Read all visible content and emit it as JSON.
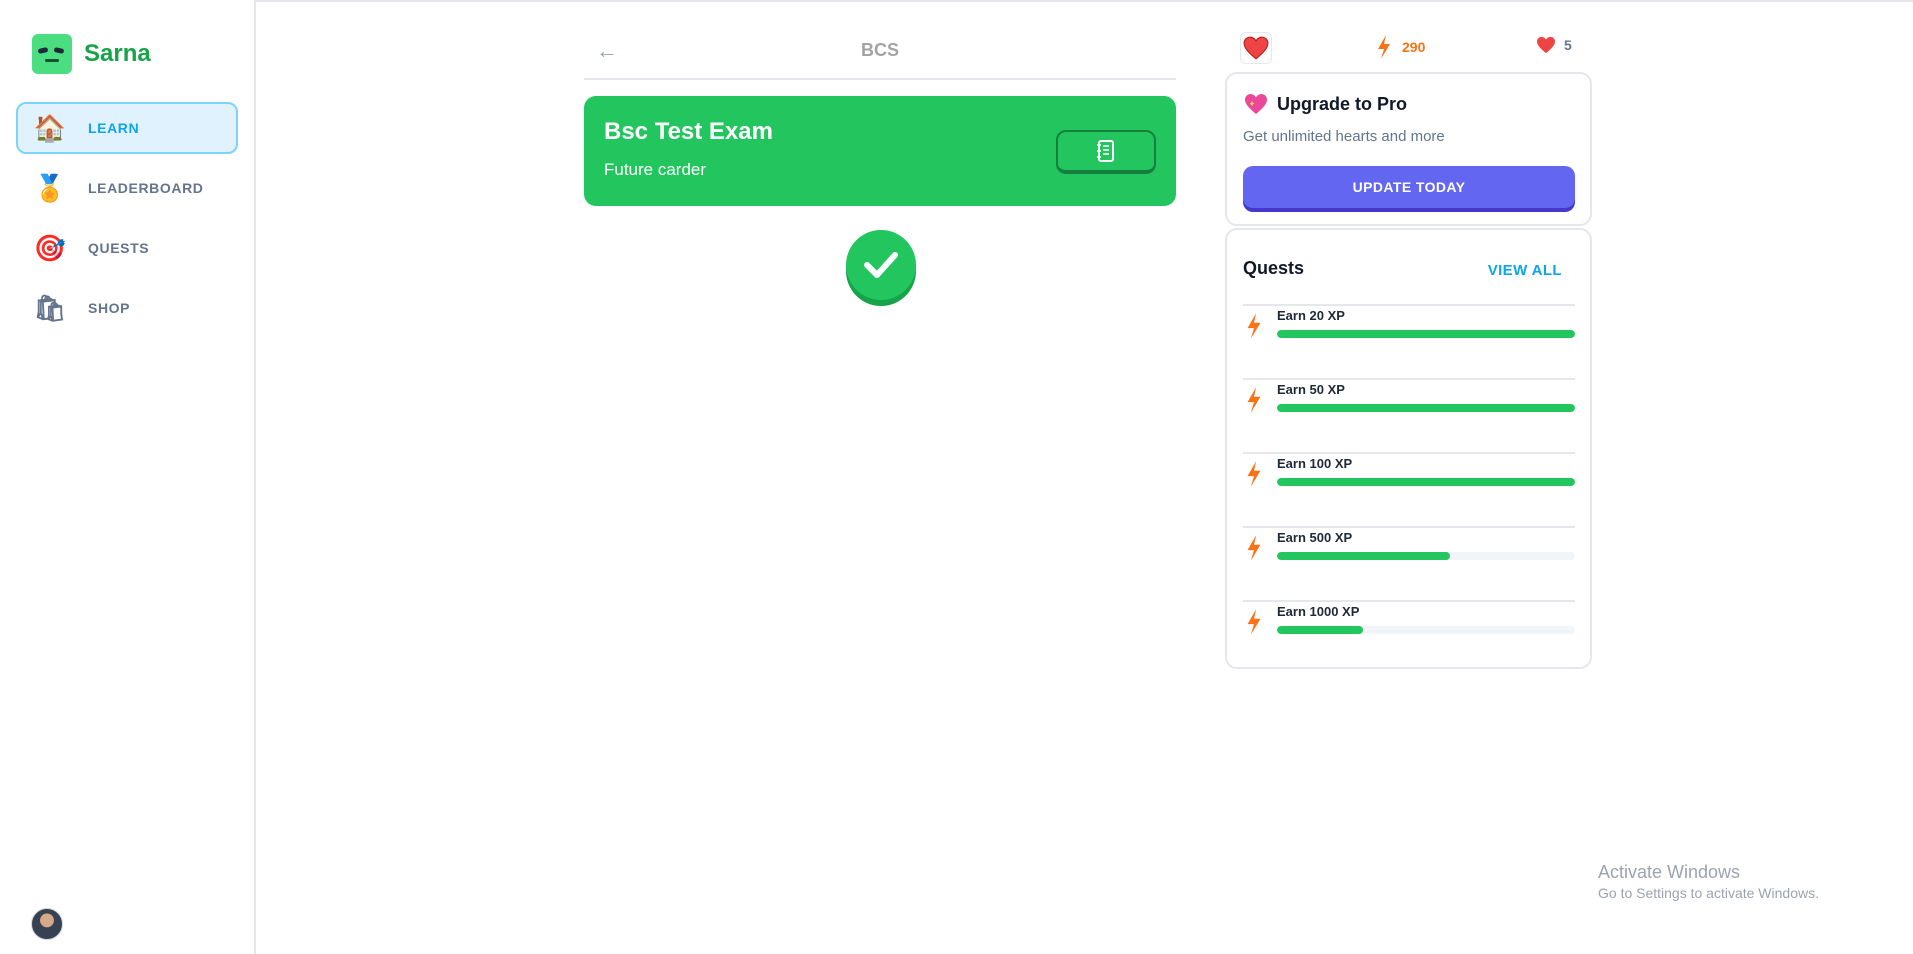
{
  "app": {
    "name": "Sarna"
  },
  "sidebar": {
    "items": [
      {
        "label": "LEARN",
        "icon": "house-icon",
        "active": true
      },
      {
        "label": "LEADERBOARD",
        "icon": "medal-icon",
        "active": false
      },
      {
        "label": "QUESTS",
        "icon": "target-icon",
        "active": false
      },
      {
        "label": "SHOP",
        "icon": "shopping-bag-icon",
        "active": false
      }
    ]
  },
  "header": {
    "title": "BCS",
    "back_icon": "arrow-left-icon"
  },
  "unit": {
    "title": "Bsc Test Exam",
    "subtitle": "Future carder",
    "guidebook_icon": "notebook-icon"
  },
  "lesson": {
    "icon": "check-icon",
    "status": "completed"
  },
  "stats": {
    "xp": "290",
    "hearts": "5"
  },
  "promo": {
    "title": "Upgrade to Pro",
    "subtitle": "Get unlimited hearts and more",
    "button_label": "UPDATE TODAY"
  },
  "quests": {
    "title": "Quests",
    "view_all_label": "VIEW ALL",
    "items": [
      {
        "label": "Earn 20 XP",
        "progress": 1.0
      },
      {
        "label": "Earn 50 XP",
        "progress": 1.0
      },
      {
        "label": "Earn 100 XP",
        "progress": 1.0
      },
      {
        "label": "Earn 500 XP",
        "progress": 0.58
      },
      {
        "label": "Earn 1000 XP",
        "progress": 0.29
      }
    ]
  },
  "watermark": {
    "title": "Activate Windows",
    "subtitle": "Go to Settings to activate Windows."
  },
  "colors": {
    "brand_green": "#22c55e",
    "accent_blue": "#0ea5e9",
    "pro_indigo": "#6366f1",
    "xp_orange": "#f97316",
    "heart_red": "#ef4444"
  }
}
